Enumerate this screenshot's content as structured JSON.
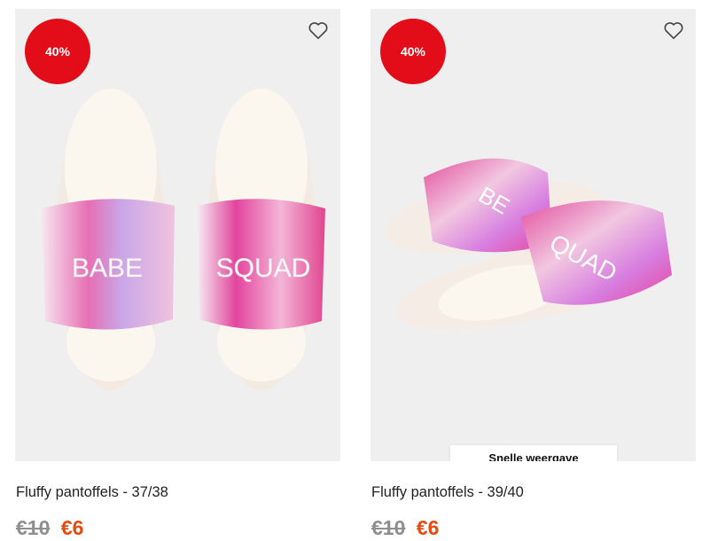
{
  "products": [
    {
      "discount_badge": "40%",
      "title": "Fluffy pantoffels - 37/38",
      "old_price": "€10",
      "new_price": "€6",
      "slipper_text_left": "BABE",
      "slipper_text_right": "SQUAD",
      "wishlist_icon": "heart-outline-icon"
    },
    {
      "discount_badge": "40%",
      "title": "Fluffy pantoffels - 39/40",
      "old_price": "€10",
      "new_price": "€6",
      "quick_view_label": "Snelle weergave",
      "slipper_text_left": "BE",
      "slipper_text_right": "QUAD",
      "wishlist_icon": "heart-outline-icon"
    }
  ],
  "colors": {
    "badge": "#e30d1a",
    "new_price": "#e64a0f",
    "old_price": "#8f8f8f",
    "image_bg": "#efefef"
  }
}
